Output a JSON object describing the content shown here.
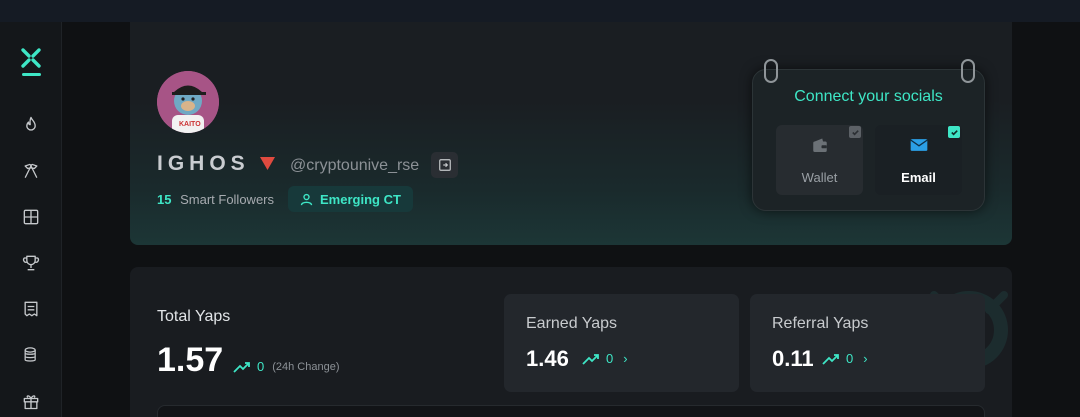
{
  "sidebar": {
    "logo_icon": "x-logo-icon",
    "items": [
      {
        "icon": "flame-icon"
      },
      {
        "icon": "crossed-flags-icon"
      },
      {
        "icon": "grid-layout-icon"
      },
      {
        "icon": "trophy-icon"
      },
      {
        "icon": "document-list-icon"
      },
      {
        "icon": "coins-stack-icon"
      },
      {
        "icon": "gift-icon"
      }
    ]
  },
  "profile": {
    "username": "IGHOS",
    "handle": "@cryptounive_rse",
    "smart_followers_count": "15",
    "smart_followers_label": "Smart Followers",
    "badge_label": "Emerging CT"
  },
  "socials": {
    "title": "Connect your socials",
    "tiles": [
      {
        "label": "Wallet",
        "icon": "wallet-icon",
        "connected": true
      },
      {
        "label": "Email",
        "icon": "envelope-icon",
        "connected": true
      }
    ]
  },
  "yaps": {
    "total_label": "Total Yaps",
    "total_value": "1.57",
    "total_change": "0",
    "change_label": "(24h Change)",
    "earned_label": "Earned Yaps",
    "earned_value": "1.46",
    "earned_change": "0",
    "referral_label": "Referral Yaps",
    "referral_value": "0.11",
    "referral_change": "0"
  },
  "colors": {
    "accent": "#3ee6c6",
    "rank_red": "#e04a3f",
    "email_blue": "#2b9fe6"
  }
}
